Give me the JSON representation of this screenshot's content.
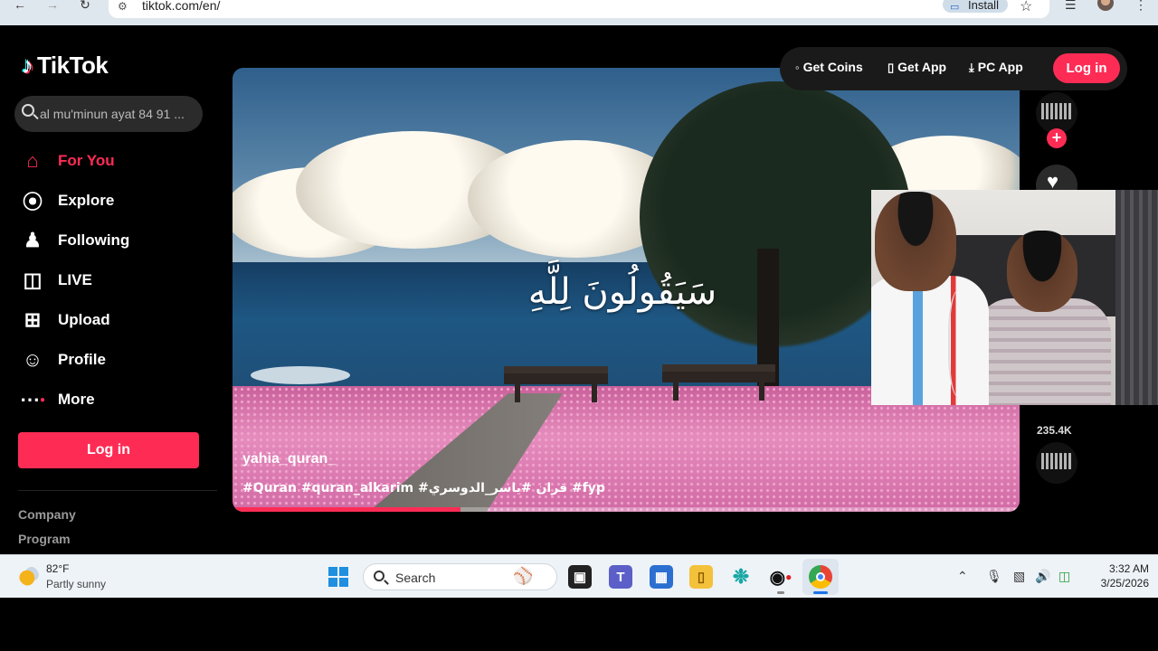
{
  "browser": {
    "url": "tiktok.com/en/",
    "install_label": "Install",
    "icons": [
      "back-arrow-icon",
      "forward-arrow-icon",
      "reload-icon",
      "site-info-icon",
      "install-app-icon",
      "star-icon",
      "media-control-icon",
      "profile-avatar",
      "menu-kebab-icon"
    ]
  },
  "sidebar": {
    "logo": "TikTok",
    "search_placeholder": "al mu'minun ayat 84 91 ...",
    "nav": [
      {
        "label": "For You",
        "icon": "home-icon",
        "active": true
      },
      {
        "label": "Explore",
        "icon": "compass-icon",
        "active": false
      },
      {
        "label": "Following",
        "icon": "following-user-icon",
        "active": false
      },
      {
        "label": "LIVE",
        "icon": "live-tv-icon",
        "active": false
      },
      {
        "label": "Upload",
        "icon": "upload-plus-icon",
        "active": false
      },
      {
        "label": "Profile",
        "icon": "profile-icon",
        "active": false
      },
      {
        "label": "More",
        "icon": "more-dots-icon",
        "active": false
      }
    ],
    "login_label": "Log in",
    "footer": [
      "Company",
      "Program"
    ]
  },
  "topbar": {
    "get_coins": "Get Coins",
    "get_app": "Get App",
    "pc_app": "PC App",
    "login_label": "Log in"
  },
  "video": {
    "overlay_text": "سَيَقُولُونَ لِلَّهِ",
    "username": "yahia_quran_",
    "caption": "#Quran #quran_alkarim #قران #ياسر_الدوسري #fyp",
    "progress": 0.29
  },
  "rail": {
    "like_count": "235.4K"
  },
  "taskbar": {
    "temperature": "82°F",
    "condition": "Partly sunny",
    "search_label": "Search",
    "time": "3:32 AM",
    "date": "3/25/2026"
  },
  "colors": {
    "accent": "#fe2c55",
    "background": "#000000",
    "sidebar_search": "#2b2b2b",
    "taskbar": "#eef3f8"
  }
}
